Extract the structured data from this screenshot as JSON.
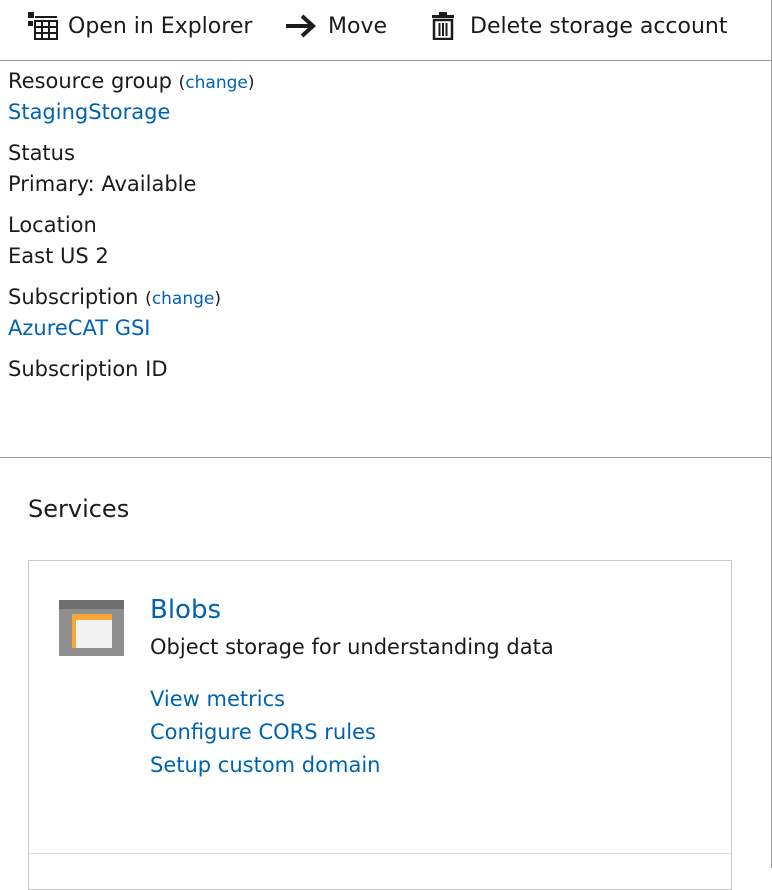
{
  "toolbar": {
    "open_in_explorer": {
      "label": "Open in Explorer",
      "icon": "explorer-grid-icon"
    },
    "move": {
      "label": "Move",
      "icon": "arrow-right-icon"
    },
    "delete": {
      "label": "Delete storage account",
      "icon": "trash-icon"
    }
  },
  "essentials": {
    "resource_group": {
      "label": "Resource group",
      "change_label": "change",
      "value": "StagingStorage"
    },
    "status": {
      "label": "Status",
      "value": "Primary: Available"
    },
    "location": {
      "label": "Location",
      "value": "East US 2"
    },
    "subscription": {
      "label": "Subscription",
      "change_label": "change",
      "value": "AzureCAT GSI"
    },
    "subscription_id": {
      "label": "Subscription ID"
    }
  },
  "services": {
    "title": "Services",
    "blobs": {
      "title": "Blobs",
      "icon": "blob-folder-icon",
      "description": "Object storage for understanding data",
      "links": [
        "View metrics",
        "Configure CORS rules",
        "Setup custom domain"
      ]
    }
  },
  "colors": {
    "link": "#0063b1",
    "text": "#1b1b1b",
    "divider": "#9a9a9a",
    "icon_orange": "#f7a733"
  }
}
